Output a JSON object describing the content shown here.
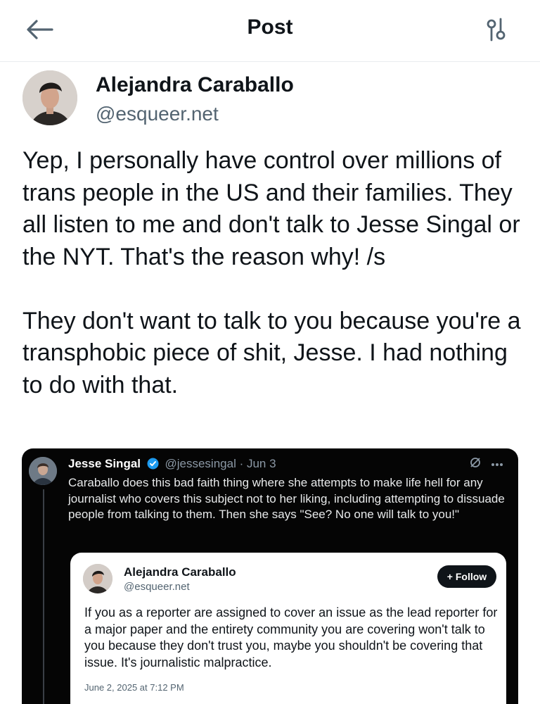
{
  "header": {
    "title": "Post",
    "back_icon": "arrow-left-icon",
    "filter_icon": "sliders-icon"
  },
  "post": {
    "author": {
      "name": "Alejandra Caraballo",
      "handle": "@esqueer.net"
    },
    "paragraphs": [
      "Yep, I personally have control over millions of trans people in the US and their families. They all listen to me and don't talk to Jesse Singal or the NYT. That's the reason why! /s",
      "They don't want to talk to you because you're a transphobic piece of shit, Jesse. I had nothing to do with that."
    ]
  },
  "quoted": {
    "name": "Jesse Singal",
    "handle": "@jessesingal",
    "date": "· Jun 3",
    "text": "Caraballo does this bad faith thing where she attempts to make life hell for any journalist who covers this subject not to her liking, including attempting to dissuade people from talking to them. Then she says \"See? No one will talk to you!\"",
    "verified_color": "#1d9bf0",
    "embedded": {
      "name": "Alejandra Caraballo",
      "handle": "@esqueer.net",
      "follow_label": "+ Follow",
      "text": "If you as a reporter are assigned to cover an issue as the lead reporter for a major paper and the entirety community you are covering won't talk to you because they don't trust you, maybe you shouldn't be covering that issue. It's journalistic malpractice.",
      "timestamp": "June 2, 2025 at 7:12 PM"
    }
  }
}
